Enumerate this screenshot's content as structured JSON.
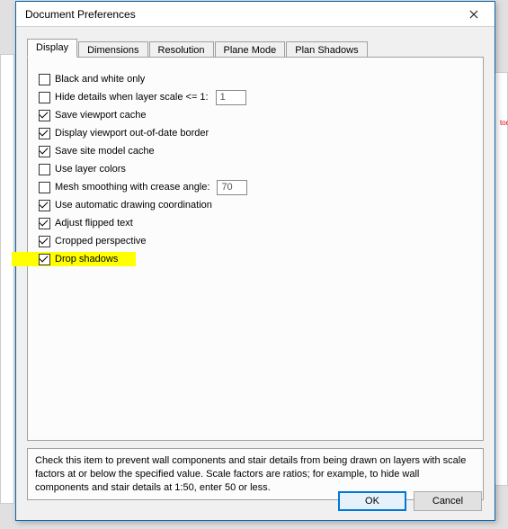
{
  "window": {
    "title": "Document Preferences"
  },
  "tabs": {
    "display": "Display",
    "dimensions": "Dimensions",
    "resolution": "Resolution",
    "plane_mode": "Plane Mode",
    "plan_shadows": "Plan Shadows"
  },
  "opts": {
    "bw": "Black and white only",
    "hide_details": "Hide details when layer scale <= 1:",
    "hide_details_val": "1",
    "save_viewport_cache": "Save viewport cache",
    "out_of_date_border": "Display viewport out-of-date border",
    "save_site_model_cache": "Save site model cache",
    "use_layer_colors": "Use layer colors",
    "mesh_smoothing": "Mesh smoothing with crease angle:",
    "mesh_val": "70",
    "auto_drawing_coord": "Use automatic drawing coordination",
    "adjust_flipped_text": "Adjust flipped text",
    "cropped_perspective": "Cropped perspective",
    "drop_shadows": "Drop shadows"
  },
  "help": "Check this item to prevent wall components and stair details from being drawn on layers with scale factors at or below the specified value.  Scale factors are ratios; for example, to hide wall components and stair details at 1:50, enter 50 or less.",
  "buttons": {
    "ok": "OK",
    "cancel": "Cancel"
  }
}
